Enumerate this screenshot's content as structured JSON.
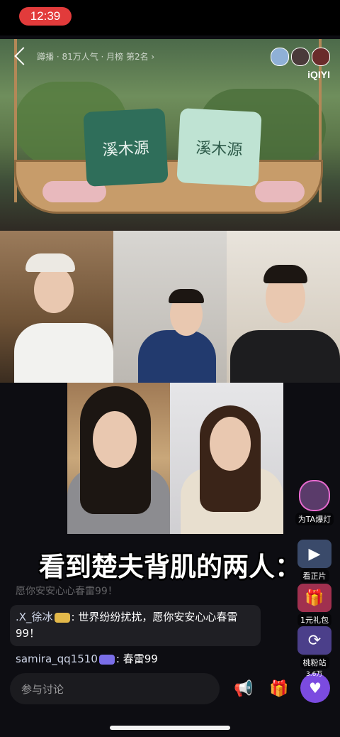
{
  "status_bar": {
    "time": "12:39"
  },
  "top_video": {
    "header_info": "蹲播 · 81万人气 · 月榜 第2名 ›",
    "logo": "iQIYI",
    "cushion_left": "溪木源",
    "cushion_right": "溪木源"
  },
  "caption": "看到楚夫背肌的两人：",
  "chat": {
    "faded_line": "愿你安安心心春雷99！",
    "message1": {
      "user": ".X_徐冰",
      "text": ": 世界纷纷扰扰，愿你安安心心春雷99！"
    },
    "message2": {
      "user": "samira_qq1510",
      "text": ": 春雷99"
    }
  },
  "side_actions": [
    {
      "label": "为TA爆灯",
      "icon": "avatar-icon"
    },
    {
      "label": "看正片",
      "icon": "video-icon"
    },
    {
      "label": "1元礼包",
      "icon": "gift-box-icon"
    },
    {
      "label": "桃粉站",
      "icon": "refresh-icon"
    }
  ],
  "bottom": {
    "comment_placeholder": "参与讨论",
    "like_count": "3.6万"
  },
  "colors": {
    "accent_red": "#e23b3b",
    "like_purple": "#7b4be0"
  }
}
